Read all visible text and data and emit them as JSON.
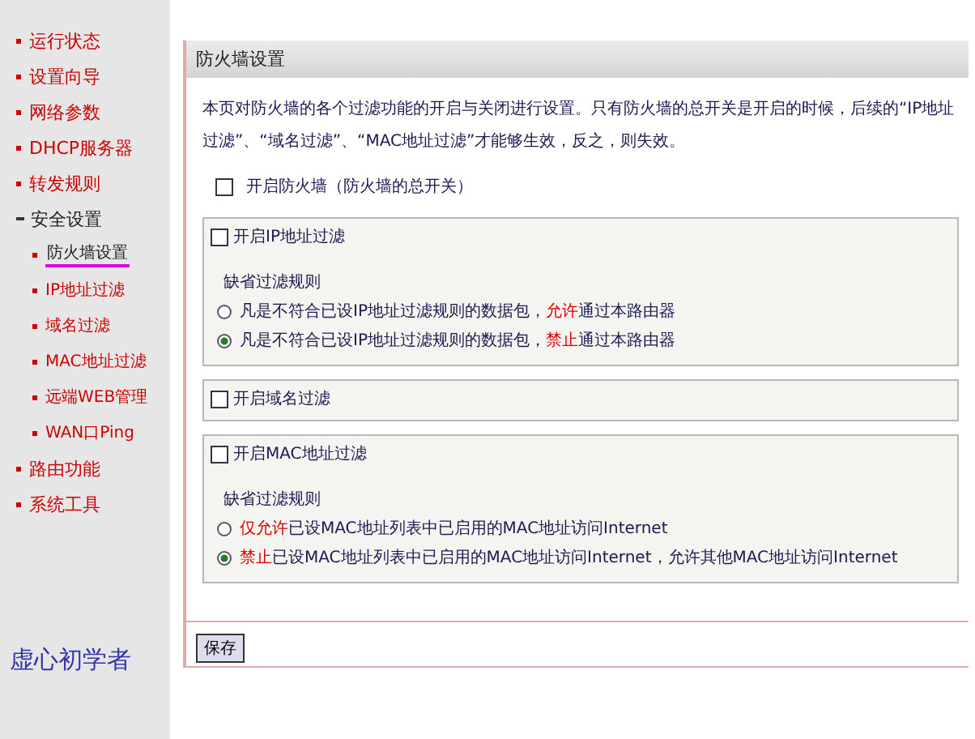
{
  "sidebar": {
    "items": [
      {
        "label": "运行状态",
        "expanded": false,
        "selected": false
      },
      {
        "label": "设置向导",
        "expanded": false,
        "selected": false
      },
      {
        "label": "网络参数",
        "expanded": false,
        "selected": false
      },
      {
        "label": "DHCP服务器",
        "expanded": false,
        "selected": false
      },
      {
        "label": "转发规则",
        "expanded": false,
        "selected": false
      },
      {
        "label": "安全设置",
        "expanded": true,
        "selected": false,
        "children": [
          {
            "label": "防火墙设置",
            "selected": true
          },
          {
            "label": "IP地址过滤",
            "selected": false
          },
          {
            "label": "域名过滤",
            "selected": false
          },
          {
            "label": "MAC地址过滤",
            "selected": false
          },
          {
            "label": "远端WEB管理",
            "selected": false
          },
          {
            "label": "WAN口Ping",
            "selected": false
          }
        ]
      },
      {
        "label": "路由功能",
        "expanded": false,
        "selected": false
      },
      {
        "label": "系统工具",
        "expanded": false,
        "selected": false
      }
    ],
    "note": "虚心初学者"
  },
  "panel": {
    "title": "防火墙设置",
    "description": "本页对防火墙的各个过滤功能的开启与关闭进行设置。只有防火墙的总开关是开启的时候，后续的“IP地址过滤”、“域名过滤”、“MAC地址过滤”才能够生效，反之，则失效。",
    "master_switch": {
      "label": "开启防火墙（防火墙的总开关）",
      "checked": false
    },
    "sections": [
      {
        "checkbox": {
          "label": "开启IP地址过滤",
          "checked": false
        },
        "rule_title": "缺省过滤规则",
        "options": [
          {
            "before": "凡是不符合已设IP地址过滤规则的数据包，",
            "highlight": "允许",
            "after": "通过本路由器",
            "selected": false
          },
          {
            "before": "凡是不符合已设IP地址过滤规则的数据包，",
            "highlight": "禁止",
            "after": "通过本路由器",
            "selected": true
          }
        ]
      },
      {
        "checkbox": {
          "label": "开启域名过滤",
          "checked": false
        }
      },
      {
        "checkbox": {
          "label": "开启MAC地址过滤",
          "checked": false
        },
        "rule_title": "缺省过滤规则",
        "options": [
          {
            "highlight": "仅允许",
            "after": "已设MAC地址列表中已启用的MAC地址访问Internet",
            "selected": false
          },
          {
            "highlight": "禁止",
            "after": "已设MAC地址列表中已启用的MAC地址访问Internet，允许其他MAC地址访问Internet",
            "selected": true
          }
        ]
      }
    ],
    "save_button": "保存"
  }
}
